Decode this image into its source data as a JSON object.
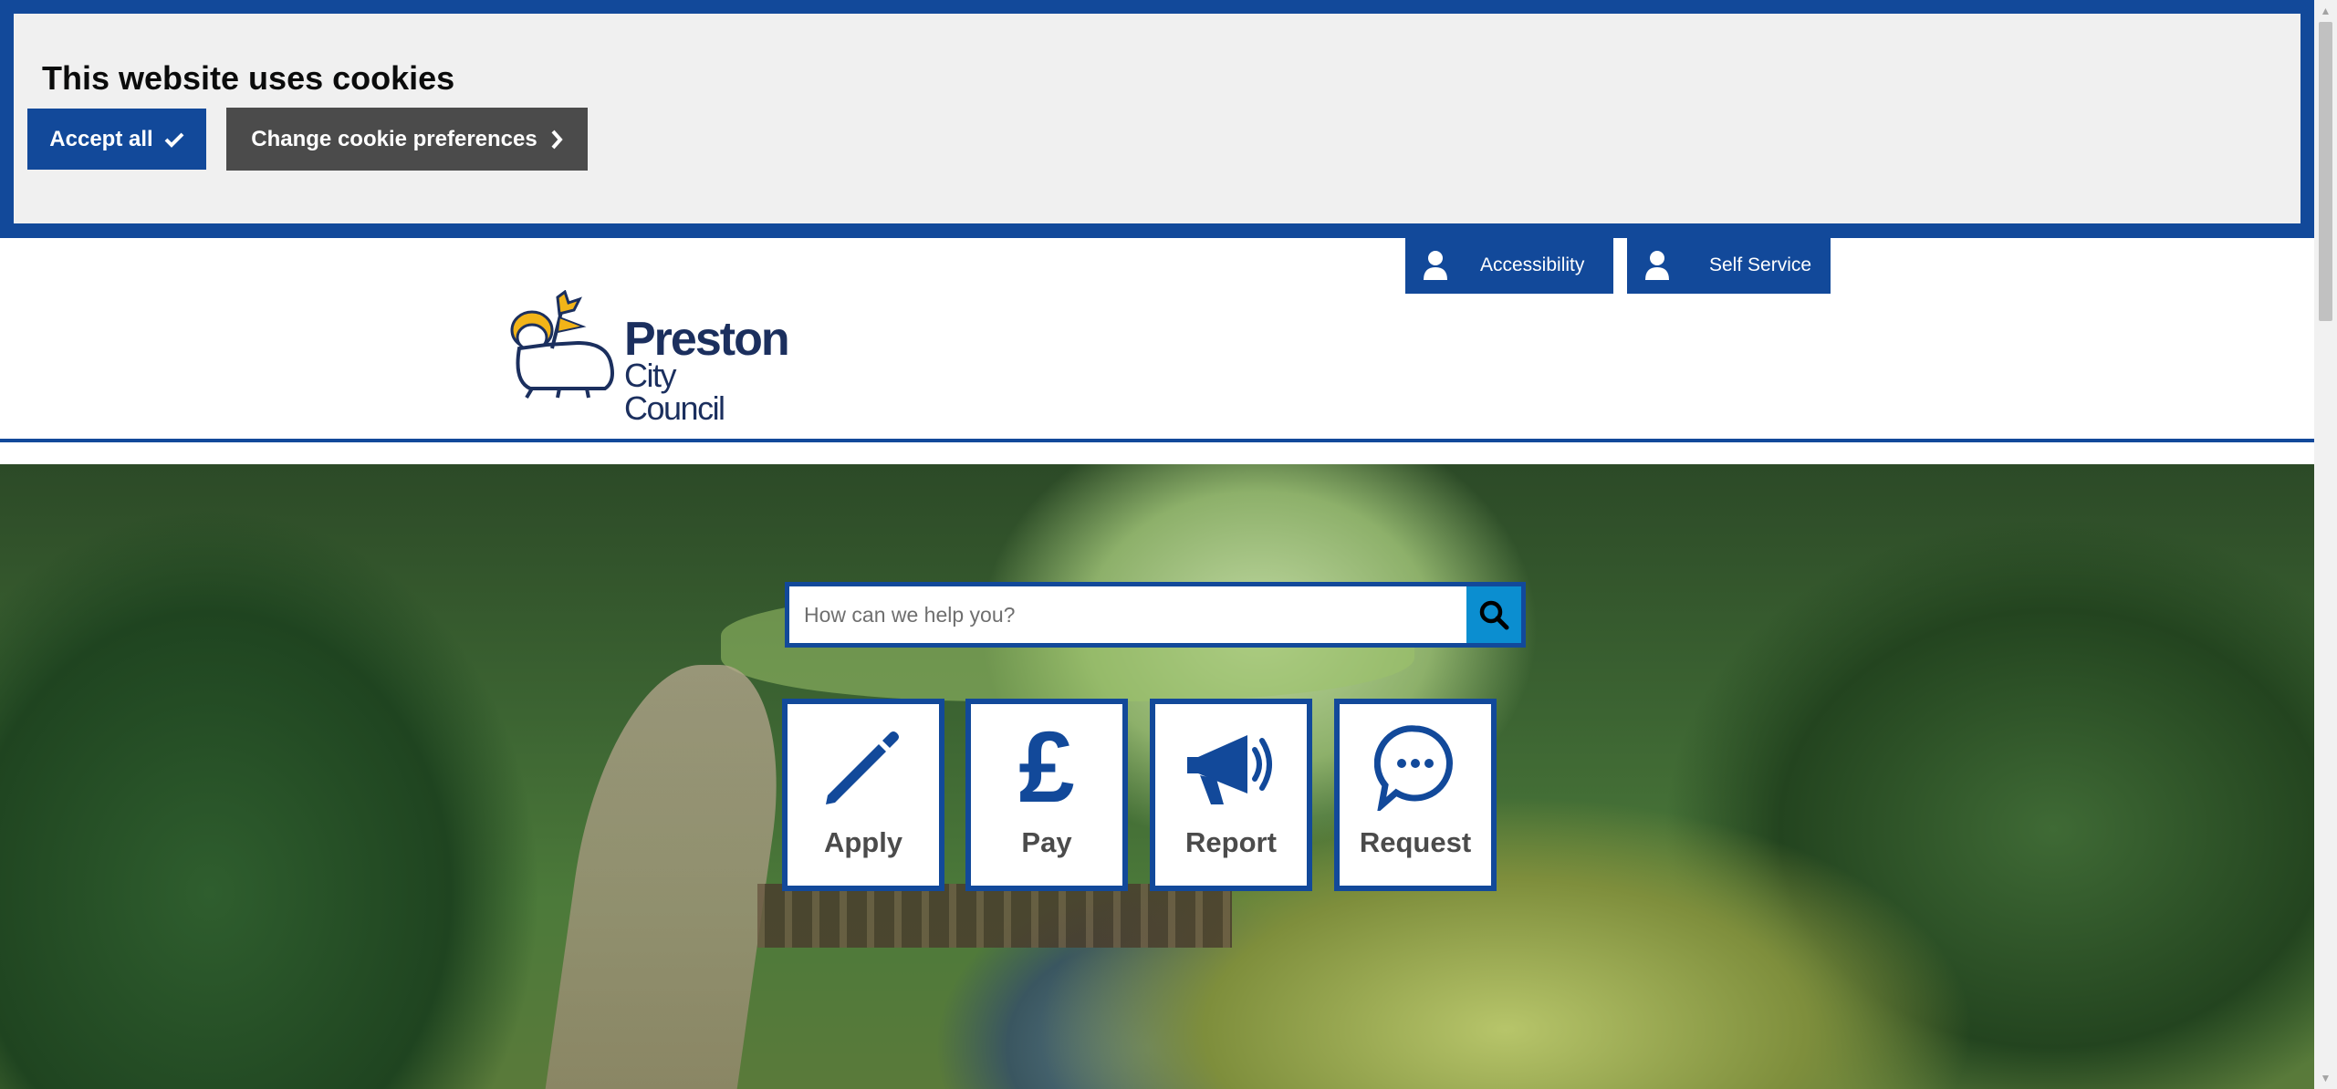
{
  "cookie_banner": {
    "title": "This website uses cookies",
    "accept_label": "Accept all",
    "preferences_label": "Change cookie preferences"
  },
  "header": {
    "utility_links": [
      {
        "label": "Accessibility",
        "icon": "user-icon"
      },
      {
        "label": "Self Service",
        "icon": "user-icon"
      }
    ],
    "logo": {
      "line1": "Preston",
      "line2": "City Council"
    }
  },
  "search": {
    "placeholder": "How can we help you?",
    "icon": "search-icon"
  },
  "tiles": [
    {
      "label": "Apply",
      "icon": "pencil-icon"
    },
    {
      "label": "Pay",
      "icon": "pound-icon"
    },
    {
      "label": "Report",
      "icon": "megaphone-icon"
    },
    {
      "label": "Request",
      "icon": "speech-bubble-icon"
    }
  ],
  "colors": {
    "brand_blue": "#12499a",
    "search_button": "#0b8ed0",
    "banner_bg": "#f0f0f0",
    "secondary_button": "#4b4b4b"
  }
}
